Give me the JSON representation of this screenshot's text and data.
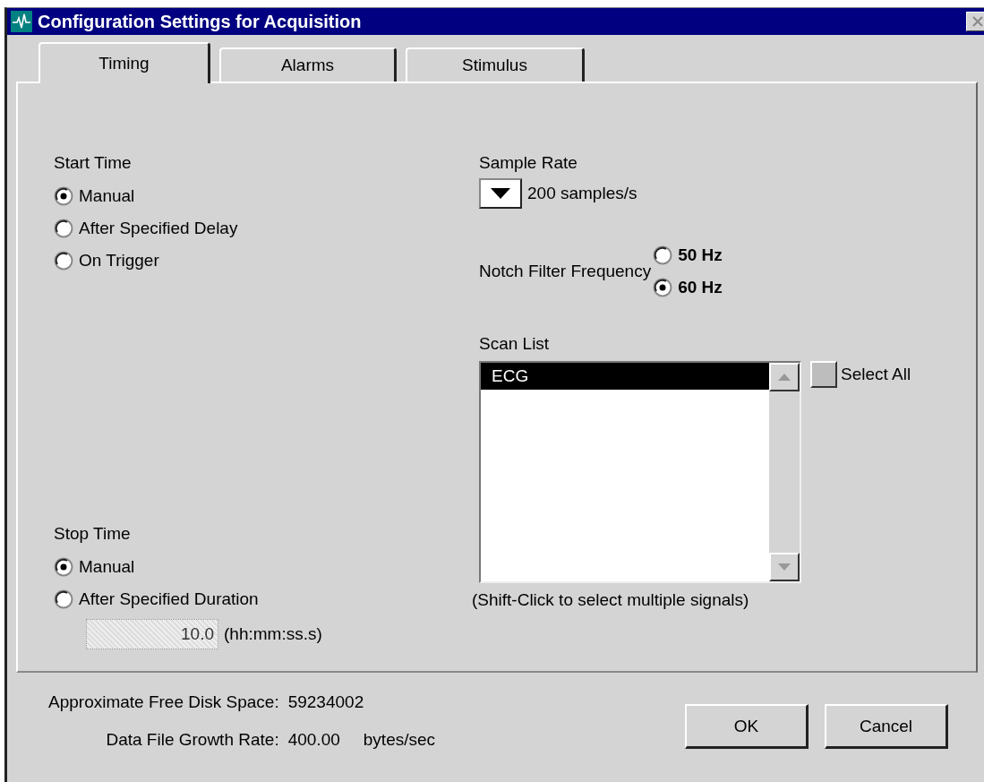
{
  "window": {
    "title": "Configuration Settings for Acquisition"
  },
  "tabs": [
    {
      "label": "Timing",
      "selected": true
    },
    {
      "label": "Alarms",
      "selected": false
    },
    {
      "label": "Stimulus",
      "selected": false
    }
  ],
  "start_time": {
    "label": "Start Time",
    "options": [
      {
        "label": "Manual",
        "selected": true
      },
      {
        "label": "After Specified Delay",
        "selected": false
      },
      {
        "label": "On Trigger",
        "selected": false
      }
    ]
  },
  "stop_time": {
    "label": "Stop Time",
    "options": [
      {
        "label": "Manual",
        "selected": true
      },
      {
        "label": "After Specified Duration",
        "selected": false
      }
    ],
    "duration": {
      "value": "10.0",
      "disabled": true
    },
    "unit": "(hh:mm:ss.s)"
  },
  "sample_rate": {
    "label": "Sample Rate",
    "value": "200 samples/s"
  },
  "notch_filter": {
    "label": "Notch Filter Frequency",
    "options": [
      {
        "label": "50 Hz",
        "selected": false
      },
      {
        "label": "60 Hz",
        "selected": true
      }
    ]
  },
  "scan_list": {
    "label": "Scan List",
    "items": [
      {
        "label": "ECG",
        "selected": true
      }
    ],
    "select_all": {
      "label": "Select All",
      "checked": false
    },
    "hint": "(Shift-Click to select multiple signals)"
  },
  "status": [
    {
      "label": "Approximate Free Disk Space:",
      "value": "59234002"
    },
    {
      "label": "Data File Growth Rate:",
      "value": "400.00",
      "unit": "bytes/sec"
    }
  ],
  "buttons": [
    "OK",
    "Cancel"
  ]
}
